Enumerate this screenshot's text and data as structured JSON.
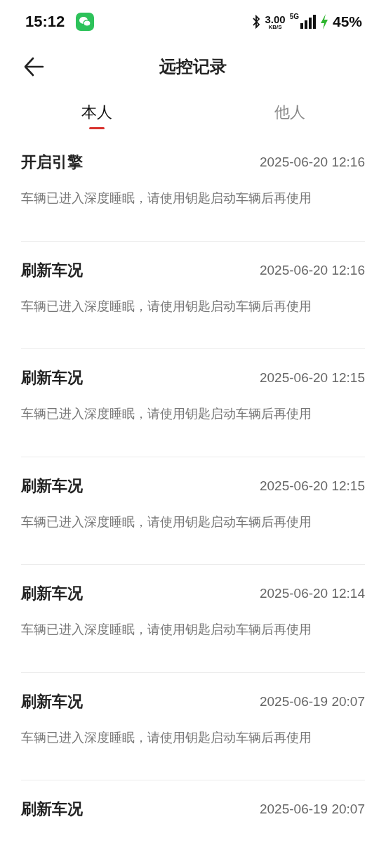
{
  "status_bar": {
    "time": "15:12",
    "speed": "3.00",
    "speed_unit": "KB/S",
    "network": "5G",
    "battery": "45%",
    "charging": true
  },
  "header": {
    "title": "远控记录"
  },
  "tabs": [
    {
      "label": "本人",
      "selected": true
    },
    {
      "label": "他人",
      "selected": false
    }
  ],
  "records": [
    {
      "title": "开启引擎",
      "time": "2025-06-20 12:16",
      "message": "车辆已进入深度睡眠，请使用钥匙启动车辆后再使用"
    },
    {
      "title": "刷新车况",
      "time": "2025-06-20 12:16",
      "message": "车辆已进入深度睡眠，请使用钥匙启动车辆后再使用"
    },
    {
      "title": "刷新车况",
      "time": "2025-06-20 12:15",
      "message": "车辆已进入深度睡眠，请使用钥匙启动车辆后再使用"
    },
    {
      "title": "刷新车况",
      "time": "2025-06-20 12:15",
      "message": "车辆已进入深度睡眠，请使用钥匙启动车辆后再使用"
    },
    {
      "title": "刷新车况",
      "time": "2025-06-20 12:14",
      "message": "车辆已进入深度睡眠，请使用钥匙启动车辆后再使用"
    },
    {
      "title": "刷新车况",
      "time": "2025-06-19 20:07",
      "message": "车辆已进入深度睡眠，请使用钥匙启动车辆后再使用"
    },
    {
      "title": "刷新车况",
      "time": "2025-06-19 20:07"
    }
  ]
}
